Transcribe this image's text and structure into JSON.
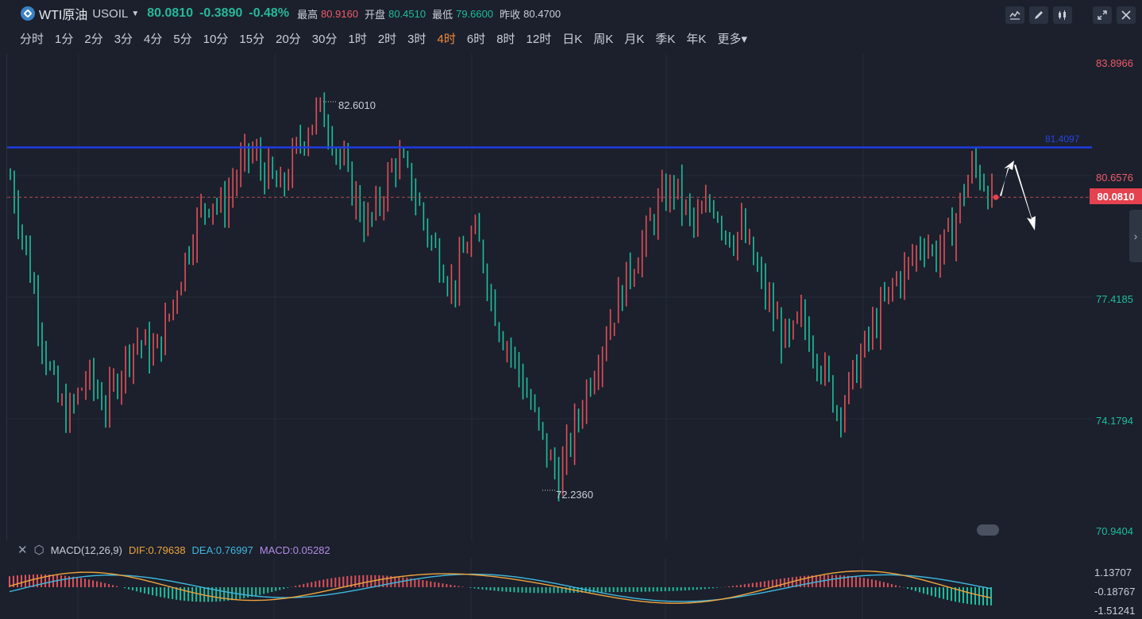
{
  "header": {
    "name": "WTI原油",
    "code": "USOIL",
    "price": "80.0810",
    "change": "-0.3890",
    "change_pct": "-0.48%",
    "high_label": "最高",
    "high": "80.9160",
    "open_label": "开盘",
    "open": "80.4510",
    "low_label": "最低",
    "low": "79.6600",
    "prev_label": "昨收",
    "prev": "80.4700"
  },
  "timeframes": [
    "分时",
    "1分",
    "2分",
    "3分",
    "4分",
    "5分",
    "10分",
    "15分",
    "20分",
    "30分",
    "1时",
    "2时",
    "3时",
    "4时",
    "6时",
    "8时",
    "12时",
    "日K",
    "周K",
    "月K",
    "季K",
    "年K",
    "更多"
  ],
  "active_timeframe": "4时",
  "toolbar_icons": [
    "indicator-icon",
    "draw-pen-icon",
    "candle-type-icon",
    "fullscreen-icon",
    "close-icon"
  ],
  "y_axis": {
    "ticks": [
      "83.8966",
      "80.6576",
      "77.4185",
      "74.1794",
      "70.9404"
    ],
    "current_price_tag": "80.0810",
    "level_line": "81.4097"
  },
  "annotations": {
    "high": "82.6010",
    "low": "72.2360"
  },
  "macd": {
    "name": "MACD(12,26,9)",
    "dif": "DIF:0.79638",
    "dea": "DEA:0.76997",
    "macd": "MACD:0.05282",
    "ticks": [
      "1.13707",
      "-0.18767",
      "-1.51241"
    ]
  },
  "colors": {
    "up": "#e0505a",
    "down": "#1fbf9e",
    "level": "#1f3be0",
    "dif": "#f0a33c",
    "dea": "#3fb8e0",
    "macd_label": "#b48ae8"
  },
  "chart_data": {
    "type": "candlestick",
    "ylim": [
      70.9404,
      83.8966
    ],
    "level_line": 81.4097,
    "close_path": [
      80.6,
      79.4,
      78.2,
      76.8,
      75.5,
      74.6,
      74.2,
      74.8,
      75.3,
      74.9,
      74.5,
      75.2,
      75.8,
      76.3,
      76.1,
      75.9,
      76.5,
      77.4,
      78.3,
      79.2,
      79.8,
      80.1,
      79.7,
      80.4,
      80.9,
      81.3,
      80.9,
      80.6,
      80.2,
      80.8,
      81.5,
      82.0,
      82.4,
      82.1,
      81.3,
      80.6,
      80.0,
      79.3,
      79.7,
      80.4,
      81.1,
      80.8,
      80.2,
      79.4,
      78.7,
      78.3,
      77.6,
      78.5,
      79.1,
      78.6,
      77.4,
      76.5,
      76.0,
      75.3,
      74.6,
      73.8,
      73.1,
      72.6,
      73.4,
      74.2,
      75.1,
      75.8,
      76.6,
      77.2,
      77.9,
      78.5,
      79.0,
      79.7,
      80.1,
      80.4,
      79.8,
      79.3,
      79.6,
      80.0,
      79.4,
      79.0,
      79.2,
      78.5,
      77.8,
      77.1,
      76.5,
      76.1,
      76.9,
      76.4,
      75.8,
      75.1,
      74.4,
      74.9,
      75.6,
      76.2,
      76.8,
      77.3,
      77.9,
      78.1,
      78.6,
      79.0,
      78.5,
      78.8,
      79.3,
      80.2,
      80.9,
      80.6,
      80.1
    ]
  }
}
